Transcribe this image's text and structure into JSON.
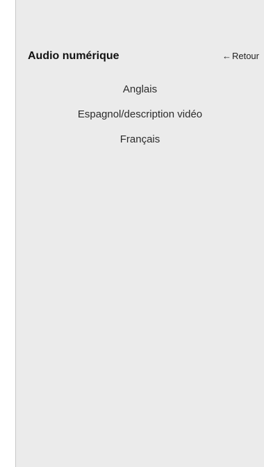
{
  "header": {
    "title": "Audio numérique",
    "back_label": "Retour",
    "back_icon": "arrow-left-icon"
  },
  "options": [
    {
      "label": "Anglais"
    },
    {
      "label": "Espagnol/description vidéo"
    },
    {
      "label": "Français"
    }
  ]
}
